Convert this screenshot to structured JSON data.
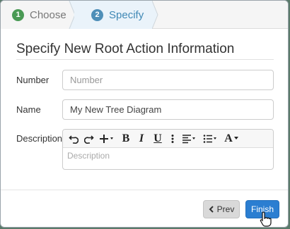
{
  "wizard": {
    "steps": [
      {
        "number": "1",
        "label": "Choose"
      },
      {
        "number": "2",
        "label": "Specify"
      }
    ]
  },
  "form": {
    "title": "Specify New Root Action Information",
    "number": {
      "label": "Number",
      "placeholder": "Number",
      "value": ""
    },
    "name": {
      "label": "Name",
      "value": "My New Tree Diagram"
    },
    "description": {
      "label": "Description",
      "placeholder": "Description"
    }
  },
  "toolbar": {
    "icons": [
      "undo-icon",
      "redo-icon",
      "insert-icon",
      "bold-icon",
      "italic-icon",
      "underline-icon",
      "more-icon",
      "align-icon",
      "list-icon",
      "font-icon"
    ],
    "bold": "B",
    "italic": "I",
    "underline": "U",
    "font": "A"
  },
  "footer": {
    "prev_label": "Prev",
    "finish_label": "Finish"
  },
  "colors": {
    "step_done": "#4a9a55",
    "step_active": "#4f8fb8",
    "primary": "#2b7ed1"
  }
}
